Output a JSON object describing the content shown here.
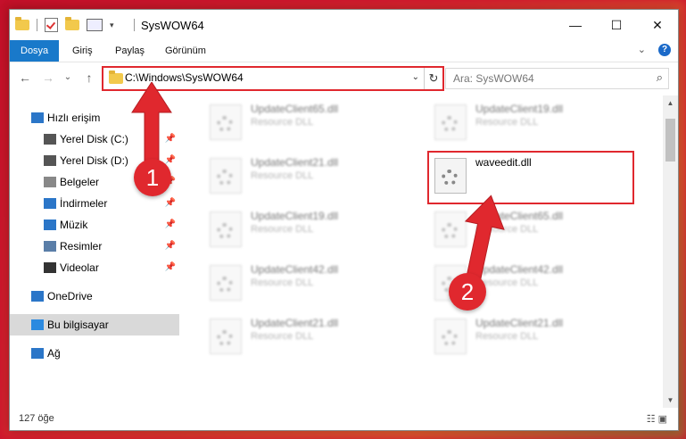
{
  "window": {
    "title": "SysWOW64",
    "minimize": "—",
    "maximize": "☐",
    "close": "✕"
  },
  "ribbon": {
    "tabs": [
      "Dosya",
      "Giriş",
      "Paylaş",
      "Görünüm"
    ],
    "expand": "⌄",
    "help": "?"
  },
  "nav_buttons": {
    "back": "←",
    "forward": "→",
    "recent": "⌄",
    "up": "↑"
  },
  "address": {
    "path": "C:\\Windows\\SysWOW64",
    "dropdown": "⌄",
    "refresh": "↻"
  },
  "search": {
    "placeholder": "Ara: SysWOW64",
    "icon": "search-icon"
  },
  "sidebar": [
    {
      "label": "Hızlı erişim",
      "icon": "star-icon"
    },
    {
      "label": "Yerel Disk (C:)",
      "icon": "drive-icon",
      "pinned": true
    },
    {
      "label": "Yerel Disk (D:)",
      "icon": "drive-icon",
      "pinned": true
    },
    {
      "label": "Belgeler",
      "icon": "document-icon",
      "pinned": true
    },
    {
      "label": "İndirmeler",
      "icon": "download-icon",
      "pinned": true
    },
    {
      "label": "Müzik",
      "icon": "music-icon",
      "pinned": true
    },
    {
      "label": "Resimler",
      "icon": "pictures-icon",
      "pinned": true
    },
    {
      "label": "Videolar",
      "icon": "video-icon",
      "pinned": true
    },
    {
      "label": "OneDrive",
      "icon": "cloud-icon"
    },
    {
      "label": "Bu bilgisayar",
      "icon": "computer-icon",
      "selected": true
    },
    {
      "label": "Ağ",
      "icon": "network-icon"
    }
  ],
  "files": [
    {
      "name": "UpdateClient65.dll",
      "type": "Resource DLL"
    },
    {
      "name": "UpdateClient19.dll",
      "type": "Resource DLL"
    },
    {
      "name": "UpdateClient21.dll",
      "type": "Resource DLL"
    },
    {
      "name": "waveedit.dll",
      "type": ""
    },
    {
      "name": "UpdateClient19.dll",
      "type": "Resource DLL"
    },
    {
      "name": "UpdateClient65.dll",
      "type": "Resource DLL"
    },
    {
      "name": "UpdateClient42.dll",
      "type": "Resource DLL"
    },
    {
      "name": "UpdateClient42.dll",
      "type": "Resource DLL"
    },
    {
      "name": "UpdateClient21.dll",
      "type": "Resource DLL"
    },
    {
      "name": "UpdateClient21.dll",
      "type": "Resource DLL"
    }
  ],
  "status": {
    "count": "127 öğe"
  },
  "annotations": {
    "badge1": "1",
    "badge2": "2"
  },
  "colors": {
    "highlight": "#e0282e",
    "file_tab": "#1979ca"
  }
}
